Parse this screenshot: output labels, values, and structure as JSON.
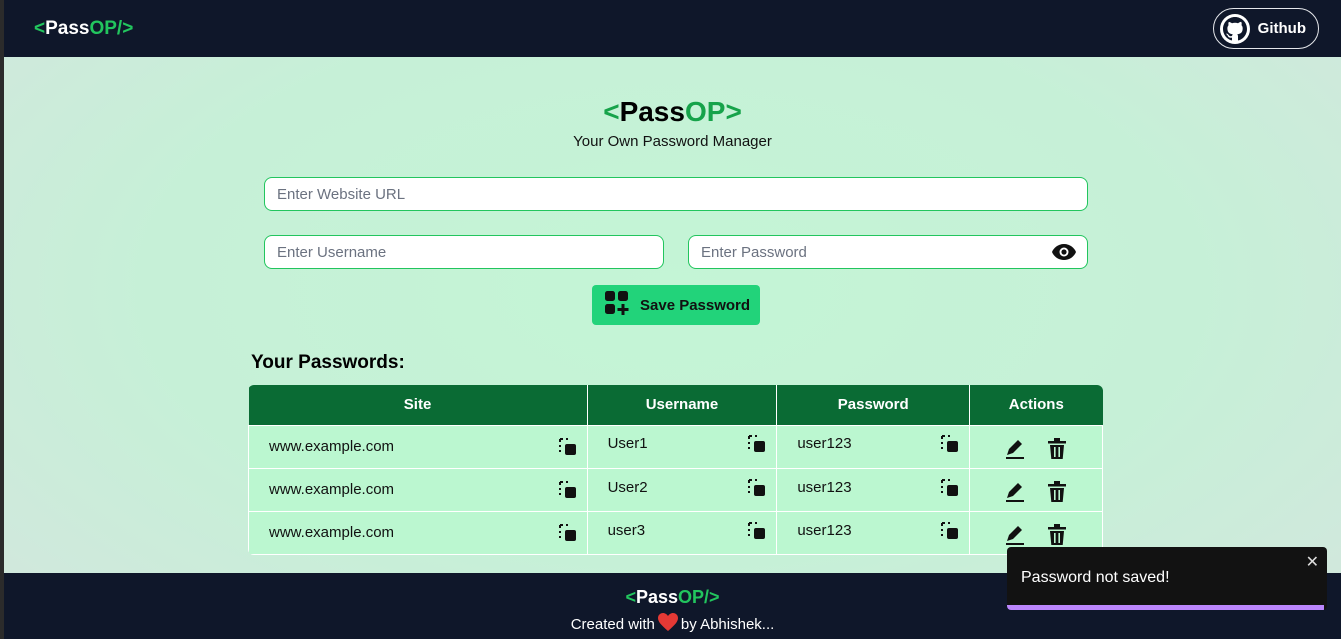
{
  "navbar": {
    "logo_left": "<",
    "logo_main": "Pass",
    "logo_accent": "OP/>",
    "github_label": "Github"
  },
  "header": {
    "title_open": "<",
    "title_main": "Pass",
    "title_accent": "OP",
    "title_close": ">",
    "subtitle": "Your Own Password Manager"
  },
  "form": {
    "website_placeholder": "Enter Website URL",
    "username_placeholder": "Enter Username",
    "password_placeholder": "Enter Password",
    "save_label": "Save Password"
  },
  "passwords": {
    "heading": "Your Passwords:",
    "columns": [
      "Site",
      "Username",
      "Password",
      "Actions"
    ],
    "rows": [
      {
        "site": "www.example.com",
        "username": "User1",
        "password": "user123"
      },
      {
        "site": "www.example.com",
        "username": "User2",
        "password": "user123"
      },
      {
        "site": "www.example.com",
        "username": "user3",
        "password": "user123"
      }
    ]
  },
  "footer": {
    "logo_open": "<",
    "logo_main": "Pass",
    "logo_accent": "OP/>",
    "credit_before": "Created with",
    "credit_after": "by Abhishek..."
  },
  "toast": {
    "message": "Password not saved!",
    "close": "✕",
    "progress": 0.99
  },
  "colors": {
    "accent": "#22c55e",
    "nav_bg": "#0f172a",
    "table_header": "#0a6b34",
    "row_bg": "#bbf7d0",
    "toast_bar": "#bb86fc"
  }
}
